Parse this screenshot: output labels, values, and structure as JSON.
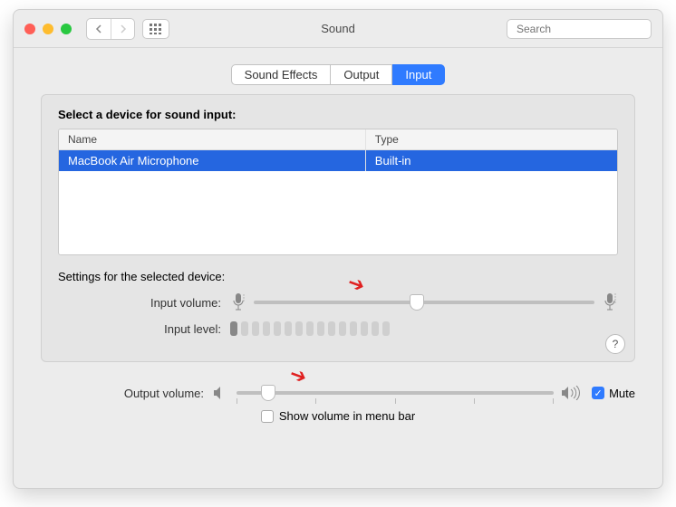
{
  "window_title": "Sound",
  "search_placeholder": "Search",
  "tabs": {
    "sound_effects": "Sound Effects",
    "output": "Output",
    "input": "Input",
    "active": "input"
  },
  "panel": {
    "title": "Select a device for sound input:",
    "columns": {
      "name": "Name",
      "type": "Type"
    },
    "rows": [
      {
        "name": "MacBook Air Microphone",
        "type": "Built-in",
        "selected": true
      }
    ],
    "settings_heading": "Settings for the selected device:",
    "input_volume_label": "Input volume:",
    "input_volume_percent": 48,
    "input_level_label": "Input level:",
    "input_level_bars_total": 15,
    "input_level_bars_lit": 1
  },
  "output": {
    "label": "Output volume:",
    "percent": 10,
    "mute_label": "Mute",
    "mute_checked": true,
    "menubar_label": "Show volume in menu bar",
    "menubar_checked": false
  },
  "help_tooltip": "?"
}
